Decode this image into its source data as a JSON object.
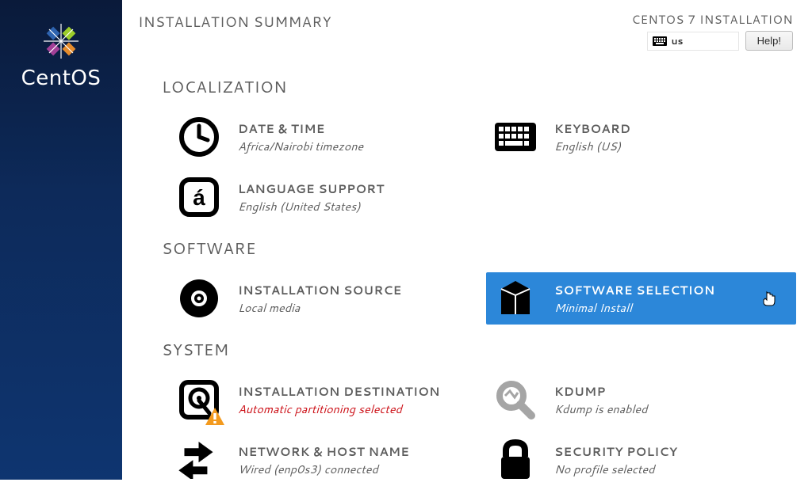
{
  "header": {
    "page_title": "INSTALLATION SUMMARY",
    "installer_name": "CENTOS 7 INSTALLATION",
    "keyboard_layout": "us",
    "help_label": "Help!"
  },
  "brand": {
    "name": "CentOS"
  },
  "sections": {
    "localization": {
      "title": "LOCALIZATION",
      "datetime": {
        "title": "DATE & TIME",
        "status": "Africa/Nairobi timezone"
      },
      "keyboard": {
        "title": "KEYBOARD",
        "status": "English (US)"
      },
      "language": {
        "title": "LANGUAGE SUPPORT",
        "status": "English (United States)"
      }
    },
    "software": {
      "title": "SOFTWARE",
      "source": {
        "title": "INSTALLATION SOURCE",
        "status": "Local media"
      },
      "selection": {
        "title": "SOFTWARE SELECTION",
        "status": "Minimal Install"
      }
    },
    "system": {
      "title": "SYSTEM",
      "destination": {
        "title": "INSTALLATION DESTINATION",
        "status": "Automatic partitioning selected"
      },
      "kdump": {
        "title": "KDUMP",
        "status": "Kdump is enabled"
      },
      "network": {
        "title": "NETWORK & HOST NAME",
        "status": "Wired (enp0s3) connected"
      },
      "security": {
        "title": "SECURITY POLICY",
        "status": "No profile selected"
      }
    }
  }
}
